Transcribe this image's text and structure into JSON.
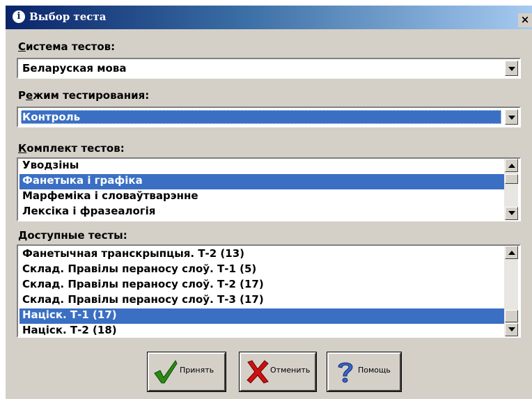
{
  "window": {
    "title": "Выбор теста",
    "close_glyph": "×",
    "title_icon": "info-icon"
  },
  "system": {
    "label_prefix": "",
    "label_accel": "С",
    "label_rest": "истема тестов:",
    "value": "Беларуская мова"
  },
  "mode": {
    "label_prefix": "Р",
    "label_accel": "е",
    "label_rest": "жим тестирования:",
    "value": "Контроль"
  },
  "kits": {
    "label_prefix": "",
    "label_accel": "К",
    "label_rest": "омплект тестов:",
    "items": [
      "Уводзіны",
      "Фанетыка і графіка",
      "Марфеміка і словаўтварэнне",
      "Лексіка і фразеалогія"
    ],
    "selected_index": 1
  },
  "tests": {
    "label_prefix": "",
    "label_accel": "Д",
    "label_rest": "оступные тесты:",
    "items": [
      "Фанетычная транскрыпцыя. Т-2 (13)",
      "Склад. Правілы пераносу слоў. Т-1 (5)",
      "Склад. Правілы пераносу слоў. Т-2 (17)",
      "Склад. Правілы пераносу слоў. Т-3 (17)",
      "Націск. Т-1 (17)",
      "Націск. Т-2 (18)"
    ],
    "selected_index": 4
  },
  "buttons": {
    "accept": {
      "label": "Принять",
      "icon": "checkmark-icon"
    },
    "cancel": {
      "label": "Отменить",
      "icon": "x-icon"
    },
    "help": {
      "label": "Помощь",
      "icon": "question-icon"
    }
  },
  "colors": {
    "selection": "#3a6fc4",
    "face": "#d4d0c8",
    "title_dark": "#0a246a"
  }
}
